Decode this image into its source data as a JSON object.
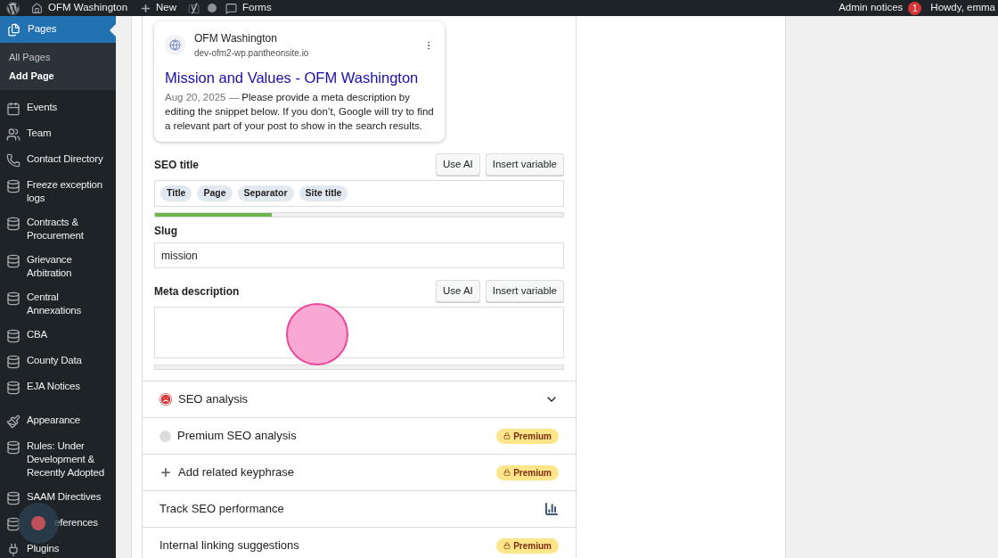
{
  "admin_bar": {
    "site_name": "OFM Washington",
    "new_label": "New",
    "forms_label": "Forms",
    "notices_label": "Admin notices",
    "notices_count": "1",
    "greeting": "Howdy, emma"
  },
  "sidebar": {
    "current": {
      "label": "Pages",
      "selected": true,
      "submenu": [
        {
          "label": "All Pages",
          "selected": false
        },
        {
          "label": "Add Page",
          "selected": true
        }
      ]
    },
    "groups": [
      [
        {
          "label": "Events",
          "kind": "calendar"
        },
        {
          "label": "Team",
          "kind": "team"
        },
        {
          "label": "Contact Directory",
          "kind": "phone"
        },
        {
          "label": "Freeze exception logs",
          "kind": "database"
        },
        {
          "label": "Contracts & Procurement",
          "kind": "database"
        },
        {
          "label": "Grievance Arbitration",
          "kind": "database"
        },
        {
          "label": "Central Annexations",
          "kind": "database"
        },
        {
          "label": "CBA",
          "kind": "database"
        },
        {
          "label": "County Data",
          "kind": "database"
        },
        {
          "label": "EJA Notices",
          "kind": "database"
        }
      ],
      [
        {
          "label": "Appearance",
          "kind": "brush"
        },
        {
          "label": "Rules: Under Development & Recently Adopted",
          "kind": "database"
        },
        {
          "label": "SAAM Directives",
          "kind": "database"
        },
        {
          "label": "eferences",
          "kind": "database",
          "under_cursor": true
        },
        {
          "label": "Plugins",
          "kind": "plugin"
        }
      ]
    ]
  },
  "preview": {
    "site_name": "OFM Washington",
    "url": "dev-ofm2-wp.pantheonsite.io",
    "title": "Mission and Values - OFM Washington",
    "date": "Aug 20, 2025",
    "separator": "—",
    "description": "Please provide a meta description by editing the snippet below. If you don’t, Google will try to find a relevant part of your post to show in the search results."
  },
  "seo_title": {
    "label": "SEO title",
    "buttons": [
      "Use AI",
      "Insert variable"
    ],
    "tokens": [
      "Title",
      "Page",
      "Separator",
      "Site title"
    ],
    "level": 0.287
  },
  "slug": {
    "label": "Slug",
    "value": "mission"
  },
  "meta_description": {
    "label": "Meta description",
    "buttons": [
      "Use AI",
      "Insert variable"
    ]
  },
  "sections": [
    {
      "label": "SEO analysis",
      "kind": "analysis"
    },
    {
      "label": "Premium SEO analysis",
      "kind": "premium",
      "badge": "Premium"
    },
    {
      "label": "Add related keyphrase",
      "kind": "add",
      "badge": "Premium"
    },
    {
      "label": "Track SEO performance",
      "kind": "track"
    },
    {
      "label": "Internal linking suggestions",
      "kind": "plain",
      "badge": "Premium"
    }
  ]
}
